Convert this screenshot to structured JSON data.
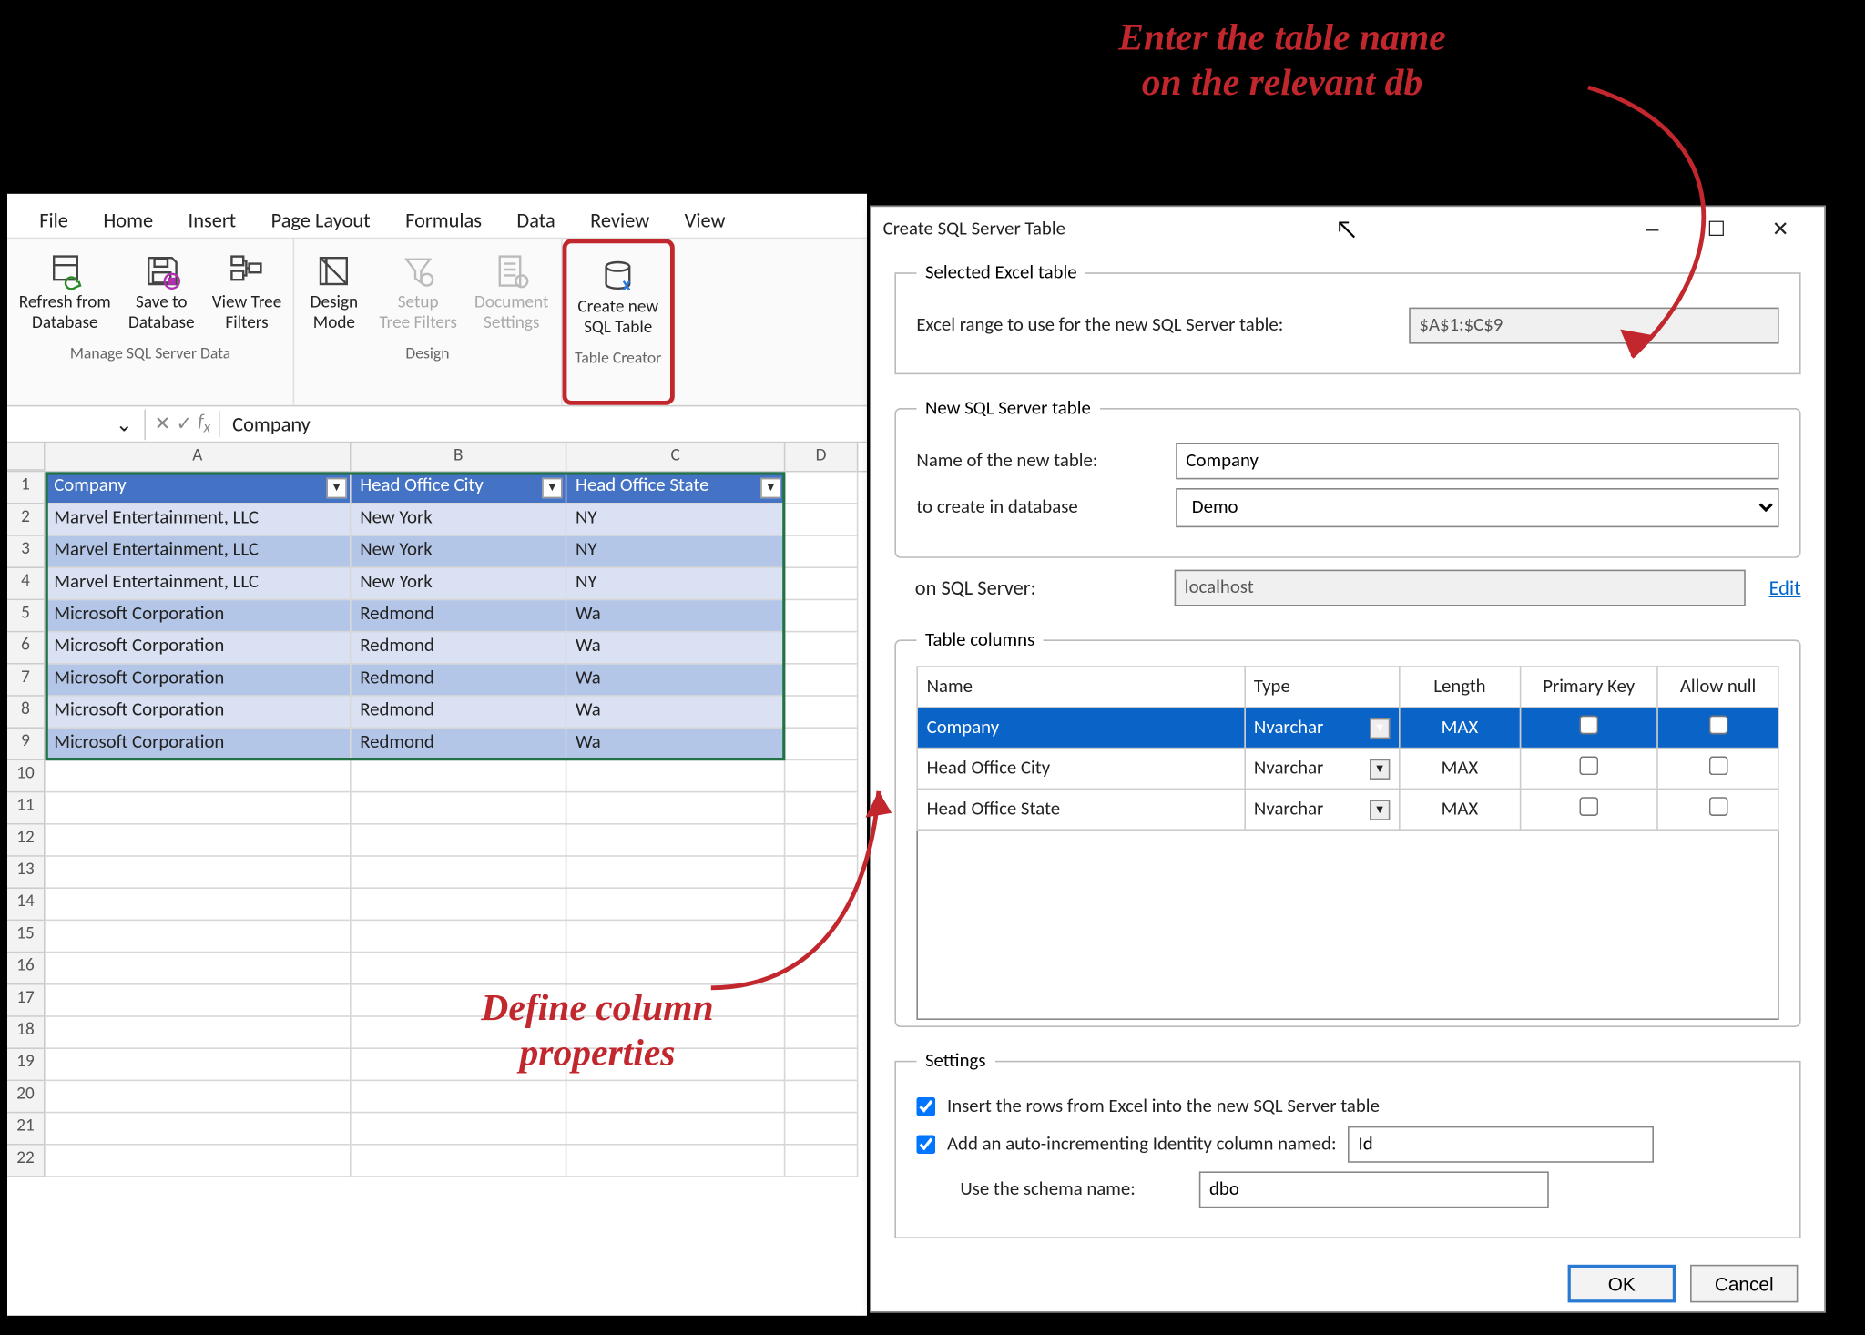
{
  "menu": [
    "File",
    "Home",
    "Insert",
    "Page Layout",
    "Formulas",
    "Data",
    "Review",
    "View"
  ],
  "ribbon": {
    "groups": [
      {
        "label": "Manage SQL Server Data",
        "buttons": [
          {
            "name": "refresh-from-db",
            "l1": "Refresh from",
            "l2": "Database"
          },
          {
            "name": "save-to-db",
            "l1": "Save to",
            "l2": "Database"
          },
          {
            "name": "view-tree-filters",
            "l1": "View Tree",
            "l2": "Filters"
          }
        ]
      },
      {
        "label": "Design",
        "buttons": [
          {
            "name": "design-mode",
            "l1": "Design",
            "l2": "Mode"
          },
          {
            "name": "setup-tree-filters",
            "l1": "Setup",
            "l2": "Tree Filters",
            "disabled": true
          },
          {
            "name": "document-settings",
            "l1": "Document",
            "l2": "Settings",
            "disabled": true
          }
        ]
      },
      {
        "label": "Table Creator",
        "buttons": [
          {
            "name": "create-new-sql-table",
            "l1": "Create new",
            "l2": "SQL Table"
          }
        ],
        "highlight": true
      }
    ]
  },
  "formula_value": "Company",
  "columns": [
    "A",
    "B",
    "C",
    "D"
  ],
  "headers": [
    "Company",
    "Head Office City",
    "Head Office State"
  ],
  "rows": [
    [
      "Marvel Entertainment, LLC",
      "New York",
      "NY"
    ],
    [
      "Marvel Entertainment, LLC",
      "New York",
      "NY"
    ],
    [
      "Marvel Entertainment, LLC",
      "New York",
      "NY"
    ],
    [
      "Microsoft Corporation",
      "Redmond",
      "Wa"
    ],
    [
      "Microsoft Corporation",
      "Redmond",
      "Wa"
    ],
    [
      "Microsoft Corporation",
      "Redmond",
      "Wa"
    ],
    [
      "Microsoft Corporation",
      "Redmond",
      "Wa"
    ],
    [
      "Microsoft Corporation",
      "Redmond",
      "Wa"
    ]
  ],
  "dialog": {
    "title": "Create SQL Server Table",
    "selected": {
      "legend": "Selected Excel table",
      "label": "Excel range to use for the new SQL Server table:",
      "value": "$A$1:$C$9"
    },
    "newtable": {
      "legend": "New SQL Server table",
      "name_label": "Name of the new table:",
      "name_value": "Company",
      "db_label": "to create in database",
      "db_value": "Demo",
      "server_label": "on SQL Server:",
      "server_value": "localhost",
      "edit": "Edit"
    },
    "cols": {
      "legend": "Table columns",
      "head": [
        "Name",
        "Type",
        "Length",
        "Primary Key",
        "Allow null"
      ],
      "rows": [
        {
          "name": "Company",
          "type": "Nvarchar",
          "len": "MAX",
          "pk": false,
          "nul": false,
          "sel": true
        },
        {
          "name": "Head Office City",
          "type": "Nvarchar",
          "len": "MAX",
          "pk": false,
          "nul": false
        },
        {
          "name": "Head Office State",
          "type": "Nvarchar",
          "len": "MAX",
          "pk": false,
          "nul": false
        }
      ]
    },
    "settings": {
      "legend": "Settings",
      "insert_label": "Insert the rows from Excel into the new SQL Server table",
      "insert_checked": true,
      "identity_label": "Add an auto-incrementing Identity column named:",
      "identity_checked": true,
      "identity_value": "Id",
      "schema_label": "Use the schema name:",
      "schema_value": "dbo"
    },
    "ok": "OK",
    "cancel": "Cancel"
  },
  "annotations": {
    "top": "Enter the table name\non the relevant db",
    "bottom": "Define column\nproperties"
  }
}
